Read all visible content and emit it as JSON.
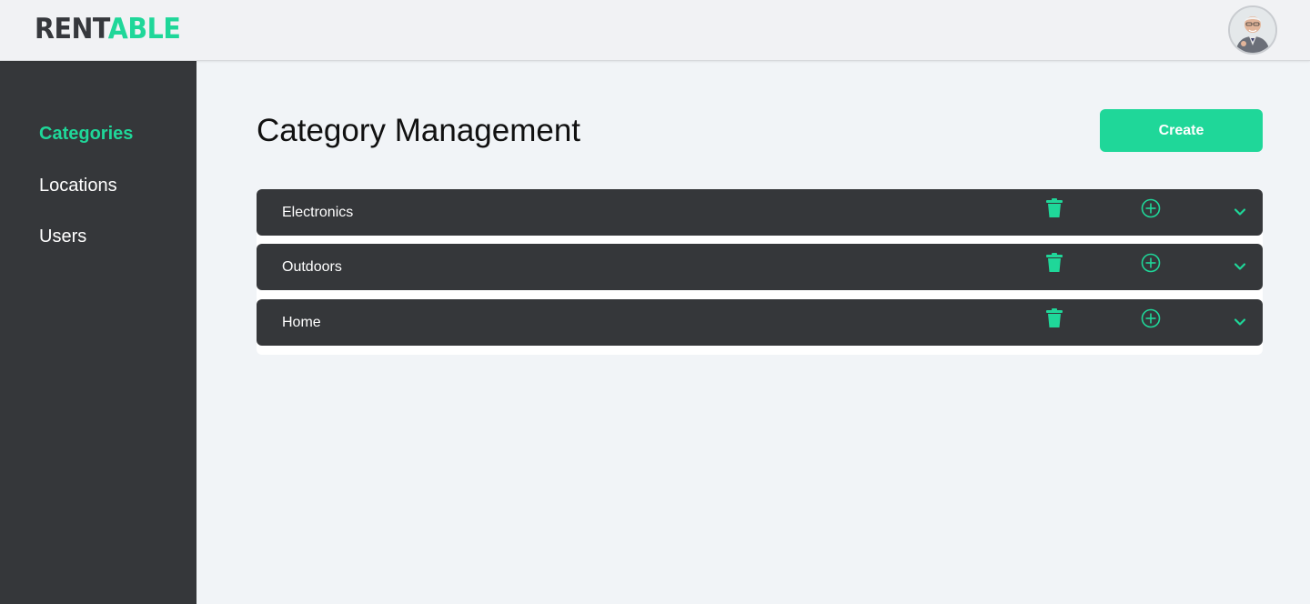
{
  "app": {
    "logo_part1": "RENT",
    "logo_part2": "ABLE",
    "brand_color": "#1fd799",
    "avatar_icon": "user-avatar"
  },
  "sidebar": {
    "items": [
      {
        "label": "Categories",
        "active": true
      },
      {
        "label": "Locations",
        "active": false
      },
      {
        "label": "Users",
        "active": false
      }
    ]
  },
  "main": {
    "title": "Category Management",
    "create_label": "Create",
    "categories": [
      {
        "name": "Electronics",
        "icons": [
          "trash-icon",
          "add-circle-icon",
          "chevron-down-icon"
        ]
      },
      {
        "name": "Outdoors",
        "icons": [
          "trash-icon",
          "add-circle-icon",
          "chevron-down-icon"
        ]
      },
      {
        "name": "Home",
        "icons": [
          "trash-icon",
          "add-circle-icon",
          "chevron-down-icon"
        ]
      }
    ]
  }
}
